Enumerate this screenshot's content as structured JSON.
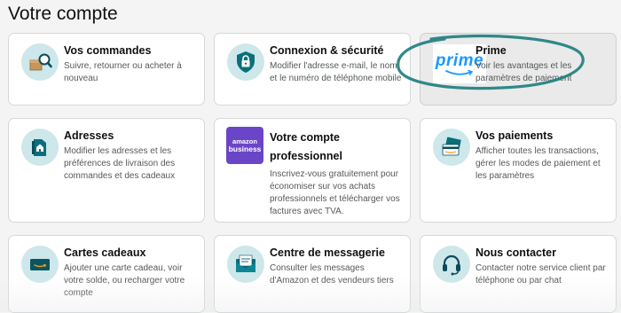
{
  "page": {
    "title": "Votre compte"
  },
  "cards": [
    {
      "id": "orders",
      "icon": "package-search-icon",
      "title": "Vos commandes",
      "description": "Suivre, retourner ou acheter à nouveau"
    },
    {
      "id": "security",
      "icon": "lock-shield-icon",
      "title": "Connexion & sécurité",
      "description": "Modifier l'adresse e-mail, le nom et le numéro de téléphone mobile"
    },
    {
      "id": "prime",
      "icon": "prime-logo",
      "logo_text": "prime",
      "title": "Prime",
      "description": "Voir les avantages et les paramètres de paiement"
    },
    {
      "id": "addresses",
      "icon": "house-map-icon",
      "title": "Adresses",
      "description": "Modifier les adresses et les préférences de livraison des commandes et des cadeaux"
    },
    {
      "id": "business",
      "icon": "amazon-business-logo",
      "logo_line1": "amazon",
      "logo_line2": "business",
      "title": "Votre compte professionnel",
      "description": "Inscrivez-vous gratuitement pour économiser sur vos achats professionnels et télécharger vos factures avec TVA."
    },
    {
      "id": "payments",
      "icon": "payment-cards-icon",
      "title": "Vos paiements",
      "description": "Afficher toutes les transactions, gérer les modes de paiement et les paramètres"
    },
    {
      "id": "giftcards",
      "icon": "gift-card-icon",
      "title": "Cartes cadeaux",
      "description": "Ajouter une carte cadeau, voir votre solde, ou recharger votre compte"
    },
    {
      "id": "messages",
      "icon": "envelope-icon",
      "title": "Centre de messagerie",
      "description": "Consulter les messages d'Amazon et des vendeurs tiers"
    },
    {
      "id": "contact",
      "icon": "headset-icon",
      "title": "Nous contacter",
      "description": "Contacter notre service client par téléphone ou par chat"
    }
  ],
  "colors": {
    "icon_circle": "#cde7ea",
    "accent_teal": "#0a7b83",
    "prime_blue": "#1a98ff",
    "business_purple": "#6b45c8",
    "annotation": "#1c7c7d"
  }
}
